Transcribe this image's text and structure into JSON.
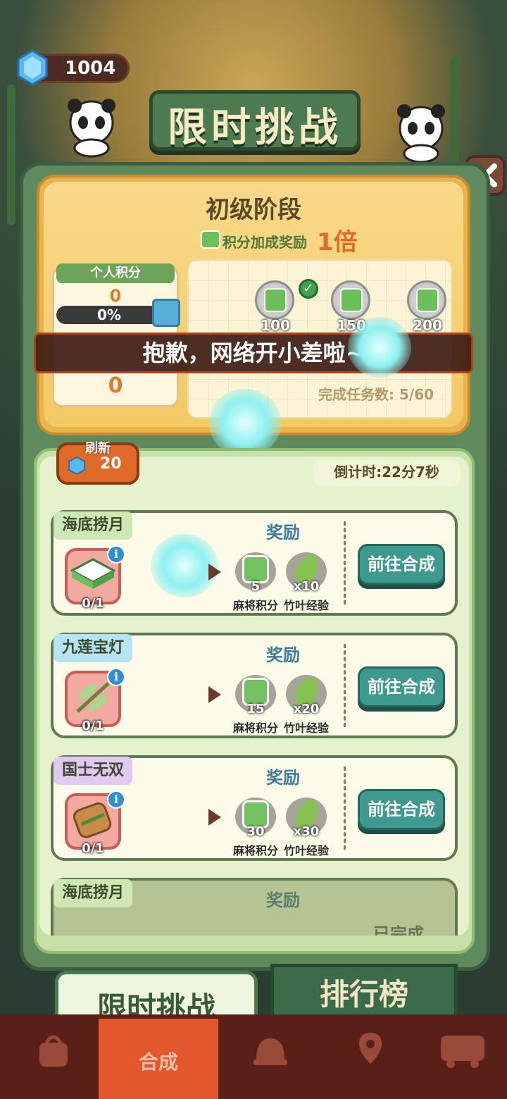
{
  "currency": {
    "gems": "1004"
  },
  "title": "限时挑战",
  "stage": {
    "name": "初级阶段",
    "bonus_label": "积分加成奖励",
    "bonus_value": "1倍",
    "personal_score_label": "个人积分",
    "personal_score": "0",
    "progress_text": "0%",
    "progress_fraction": 0,
    "second_score": "0",
    "milestones": [
      {
        "label": "100",
        "claimed": true
      },
      {
        "label": "150",
        "claimed": false
      },
      {
        "label": "200",
        "claimed": false
      }
    ],
    "tasks_done_label": "完成任务数:",
    "tasks_done_value": "5/60"
  },
  "toast": "抱歉，网络开小差啦~",
  "list": {
    "refresh_label": "刷新",
    "refresh_cost": "20",
    "countdown": "倒计时:22分7秒",
    "tasks": [
      {
        "tag": "海底捞月",
        "tag_color": "#cfe7b4",
        "count": "0/1",
        "reward_title": "奖励",
        "rewards": [
          {
            "num": "5",
            "label": "麻将积分"
          },
          {
            "num": "x10",
            "label": "竹叶经验"
          }
        ],
        "button": "前往合成",
        "done": false
      },
      {
        "tag": "九莲宝灯",
        "tag_color": "#b6e4f2",
        "count": "0/1",
        "reward_title": "奖励",
        "rewards": [
          {
            "num": "15",
            "label": "麻将积分"
          },
          {
            "num": "x20",
            "label": "竹叶经验"
          }
        ],
        "button": "前往合成",
        "done": false
      },
      {
        "tag": "国士无双",
        "tag_color": "#e3c8f2",
        "count": "0/1",
        "reward_title": "奖励",
        "rewards": [
          {
            "num": "30",
            "label": "麻将积分"
          },
          {
            "num": "x30",
            "label": "竹叶经验"
          }
        ],
        "button": "前往合成",
        "done": false
      },
      {
        "tag": "海底捞月",
        "tag_color": "#cfe7b4",
        "reward_title": "奖励",
        "status": "已完成",
        "done": true
      }
    ]
  },
  "tabs": {
    "active": "限时挑战",
    "other": "排行榜"
  },
  "bottom_nav": {
    "active_label": "合成",
    "icons": [
      "bag-icon",
      "merge-icon",
      "bell-icon",
      "map-icon",
      "bus-icon"
    ]
  },
  "colors": {
    "accent": "#3e9a8e",
    "warning": "#e06a2a",
    "bonus": "#e26a28"
  }
}
